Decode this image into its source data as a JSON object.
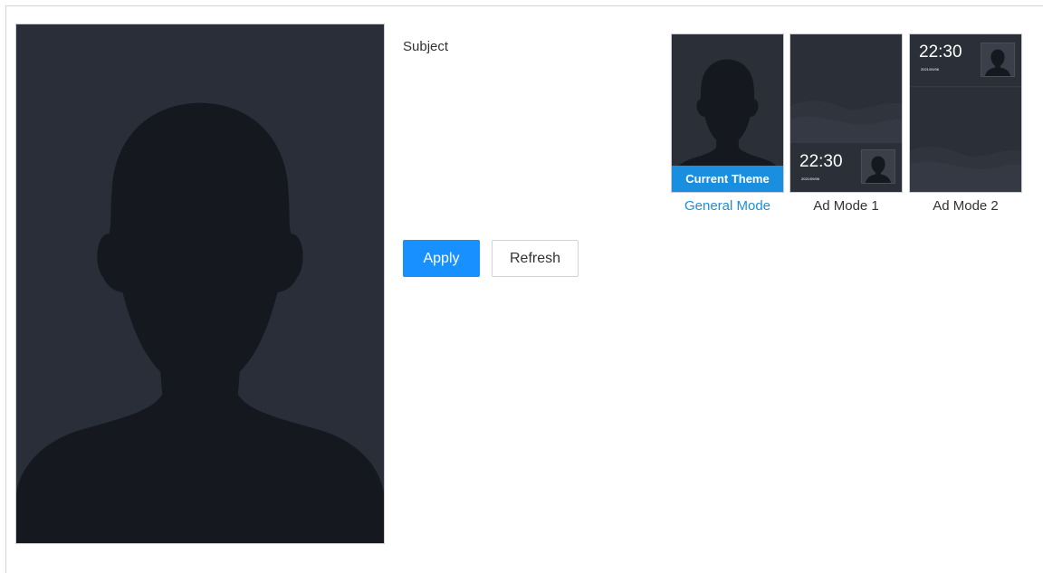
{
  "form": {
    "subject_label": "Subject",
    "apply_label": "Apply",
    "refresh_label": "Refresh"
  },
  "themes": [
    {
      "caption": "General Mode",
      "badge": "Current Theme",
      "active": true
    },
    {
      "caption": "Ad Mode 1",
      "time": "22:30",
      "date": "2021/09/06"
    },
    {
      "caption": "Ad Mode 2",
      "time": "22:30",
      "date": "2021/09/06"
    }
  ],
  "colors": {
    "accent": "#1890ff",
    "badge": "#1a8fe0",
    "preview_bg": "#2a2e39",
    "silhouette": "#15181e"
  },
  "icons": {
    "preview": "person-silhouette-icon"
  }
}
